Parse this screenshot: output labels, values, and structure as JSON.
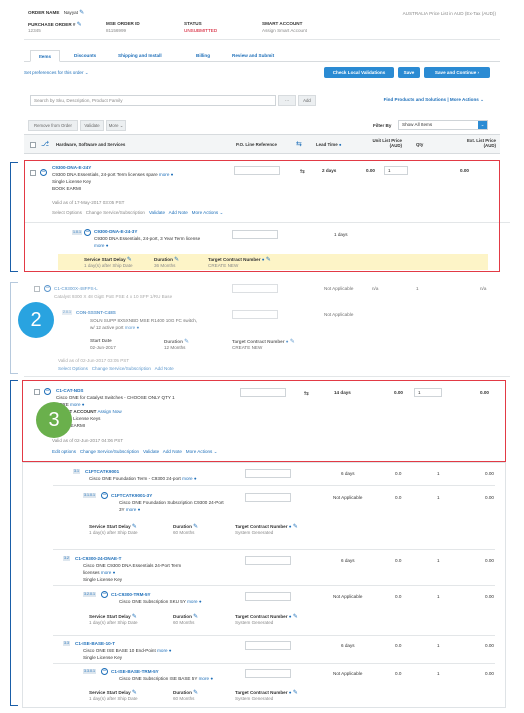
{
  "colors": {
    "accent": "#2b8bd3",
    "status_red": "#d0021b",
    "highlight_box": "#e23a45",
    "annotation_blue": "#29a3e0",
    "annotation_green": "#6ab04c",
    "service_band": "#fdf4c7"
  },
  "header": {
    "order_name_label": "ORDER NAME",
    "order_name_value": "Nayyat",
    "price_list": "AUSTRALIA Price List in AUD (Ex-Tax (AUD))",
    "po_label": "PURCHASE ORDER #",
    "po_value": "12345",
    "mse_label": "MSE ORDER ID",
    "mse_value": "81156999",
    "status_label": "STATUS",
    "status_value": "UNSUBMITTED",
    "smart_label": "SMART ACCOUNT",
    "smart_value": "Assign Smart Account"
  },
  "tabs": [
    "Items",
    "Discounts",
    "Shipping and Install",
    "Billing",
    "Review and Submit"
  ],
  "toolbar": {
    "preferences": "Set preferences for this order",
    "check_local": "Check Local Validations",
    "save": "Save",
    "save_continue": "Save and Continue",
    "search_placeholder": "Search by Sku, Description, Product Family",
    "add": "Add",
    "find_products": "Find Products and Solutions | More Actions",
    "remove": "Remove from Order",
    "validate": "Validate",
    "more": "More",
    "filter_by": "Filter By",
    "filter_value": "Show All Items"
  },
  "columns": {
    "hw": "Hardware, Software and Services",
    "po_ref": "P.O. Line Reference",
    "lead": "Lead Time",
    "unit_price": "Unit List Price (AUD)",
    "qty": "Qty",
    "ext_price": "Ext. List Price (AUD)"
  },
  "items": {
    "i1": {
      "sku": "C9300-DNA-E-24Y",
      "desc": "C9300 DNA Essentials, 24-port Term licenses spare",
      "more": "more",
      "type": "Single License Key",
      "code": "BOOK EARMI",
      "valid": "Valid as of 17-May-2017 03:05 PST",
      "actions": [
        "Select Options",
        "Change Service/Subscription",
        "Validate",
        "Add Note",
        "More Actions"
      ],
      "lead": "2 days",
      "unit": "0.00",
      "qty": "1",
      "ext": "0.00"
    },
    "i1a": {
      "num": "1.0.1",
      "sku": "C9300-DNA-E-24-3Y",
      "desc": "C9300 DNA Essentials, 24-port, 3 Year Term license",
      "more": "more",
      "lead": "1 days"
    },
    "svc1": {
      "start_label": "Service Start Delay",
      "start_value": "1 day(s) after Ship Date",
      "dur_label": "Duration",
      "dur_value": "36 Months",
      "tcn_label": "Target Contract Number",
      "tcn_value": "CREATE NEW"
    },
    "i2": {
      "sku": "C1-C9300X-48FPS-L",
      "desc": "Catalyst 9300 X 48 GigE PoE PSE 4 x 10 SFP 1/RU Base",
      "lead": "Not Applicable",
      "unit": "n/a",
      "qty": "1",
      "ext": "n/a"
    },
    "i2a": {
      "num": "2.0.1",
      "sku": "CON-SSSNT-C48S",
      "desc": "SOLN SUPP 8X5XNBD MSE R1400 10G FC switch,",
      "desc2": "w/ 12 active port",
      "more": "more",
      "lead": "Not Applicable",
      "start_label": "Start Date",
      "start_value": "02-Jun-2017",
      "dur_label": "Duration",
      "dur_value": "12 Months",
      "tcn_label": "Target Contract Number",
      "tcn_value": "CREATE NEW",
      "valid": "Valid as of 02-Jun-2017 03:05 PST",
      "actions": [
        "Select Options",
        "Change Service/Subscription",
        "Add Note"
      ]
    },
    "i3": {
      "sku": "C1-CAT-NDS",
      "desc": "Cisco ONE for Catalyst Switches - CHOOSE ONLY QTY 1",
      "desc2": "HERE",
      "more": "more",
      "smart": "SMART ACCOUNT",
      "assign": "Assign Now",
      "type": "Multiple License Keys",
      "code": "BOOK EARMI",
      "valid": "Valid as of 02-Jun-2017 04:06 PST",
      "actions": [
        "Edit options",
        "Change Service/Subscription",
        "Validate",
        "Add Note",
        "More Actions"
      ],
      "lead": "14 days",
      "unit": "0.00",
      "qty": "1",
      "ext": "0.00"
    },
    "s1": {
      "num": "3.1",
      "sku": "C1FTCATK9001",
      "desc": "Cisco ONE Foundation Term - C9300 24-port",
      "more": "more",
      "lead": "6 days",
      "unit": "0.0",
      "qty": "1",
      "ext": "0.00"
    },
    "s1a": {
      "num": "3.1.0.1",
      "sku": "C1FTCATK9001-3Y",
      "desc": "Cisco ONE Foundation Subscription C9300 24-Port",
      "desc2": "3Y",
      "more": "more",
      "lead": "Not Applicable",
      "unit": "0.0",
      "qty": "1",
      "ext": "0.00",
      "start_label": "Service Start Delay",
      "start_value": "1 day(s) after Ship Date",
      "dur_label": "Duration",
      "dur_value": "60 Months",
      "tcn_label": "Target Contract Number",
      "tcn_value": "System Generated"
    },
    "s2": {
      "num": "3.2",
      "sku": "C1-C9300-24-DNAE-T",
      "desc": "Cisco ONE C9300 DNA Essentials 24-Port Term",
      "desc2": "licenses",
      "more": "more",
      "type": "Single License Key",
      "lead": "6 days",
      "unit": "0.0",
      "qty": "1",
      "ext": "0.00"
    },
    "s2a": {
      "num": "3.2.0.1",
      "sku": "C1-C9300-TRM-5Y",
      "desc": "Cisco ONE Subscription SKU 5Y",
      "more": "more",
      "lead": "Not Applicable",
      "unit": "0.0",
      "qty": "1",
      "ext": "0.00",
      "start_label": "Service Start Delay",
      "start_value": "1 day(s) after Ship Date",
      "dur_label": "Duration",
      "dur_value": "60 Months",
      "tcn_label": "Target Contract Number",
      "tcn_value": "System Generated"
    },
    "s3": {
      "num": "3.3",
      "sku": "C1-ISE-BASE-10-T",
      "desc": "Cisco ONE ISE BASE 10 End-Point",
      "more": "more",
      "type": "Single License Key",
      "lead": "6 days",
      "unit": "0.0",
      "qty": "1",
      "ext": "0.00"
    },
    "s3a": {
      "num": "3.3.0.1",
      "sku": "C1-ISE-BASE-TRM-5Y",
      "desc": "Cisco ONE Subscription ISE BASE 5Y",
      "more": "more",
      "lead": "Not Applicable",
      "unit": "0.0",
      "qty": "1",
      "ext": "0.00",
      "start_label": "Service Start Delay",
      "start_value": "1 day(s) after Ship Date",
      "dur_label": "Duration",
      "dur_value": "60 Months",
      "tcn_label": "Target Contract Number",
      "tcn_value": "System Generated"
    }
  },
  "annotations": {
    "two": "2",
    "three": "3"
  }
}
